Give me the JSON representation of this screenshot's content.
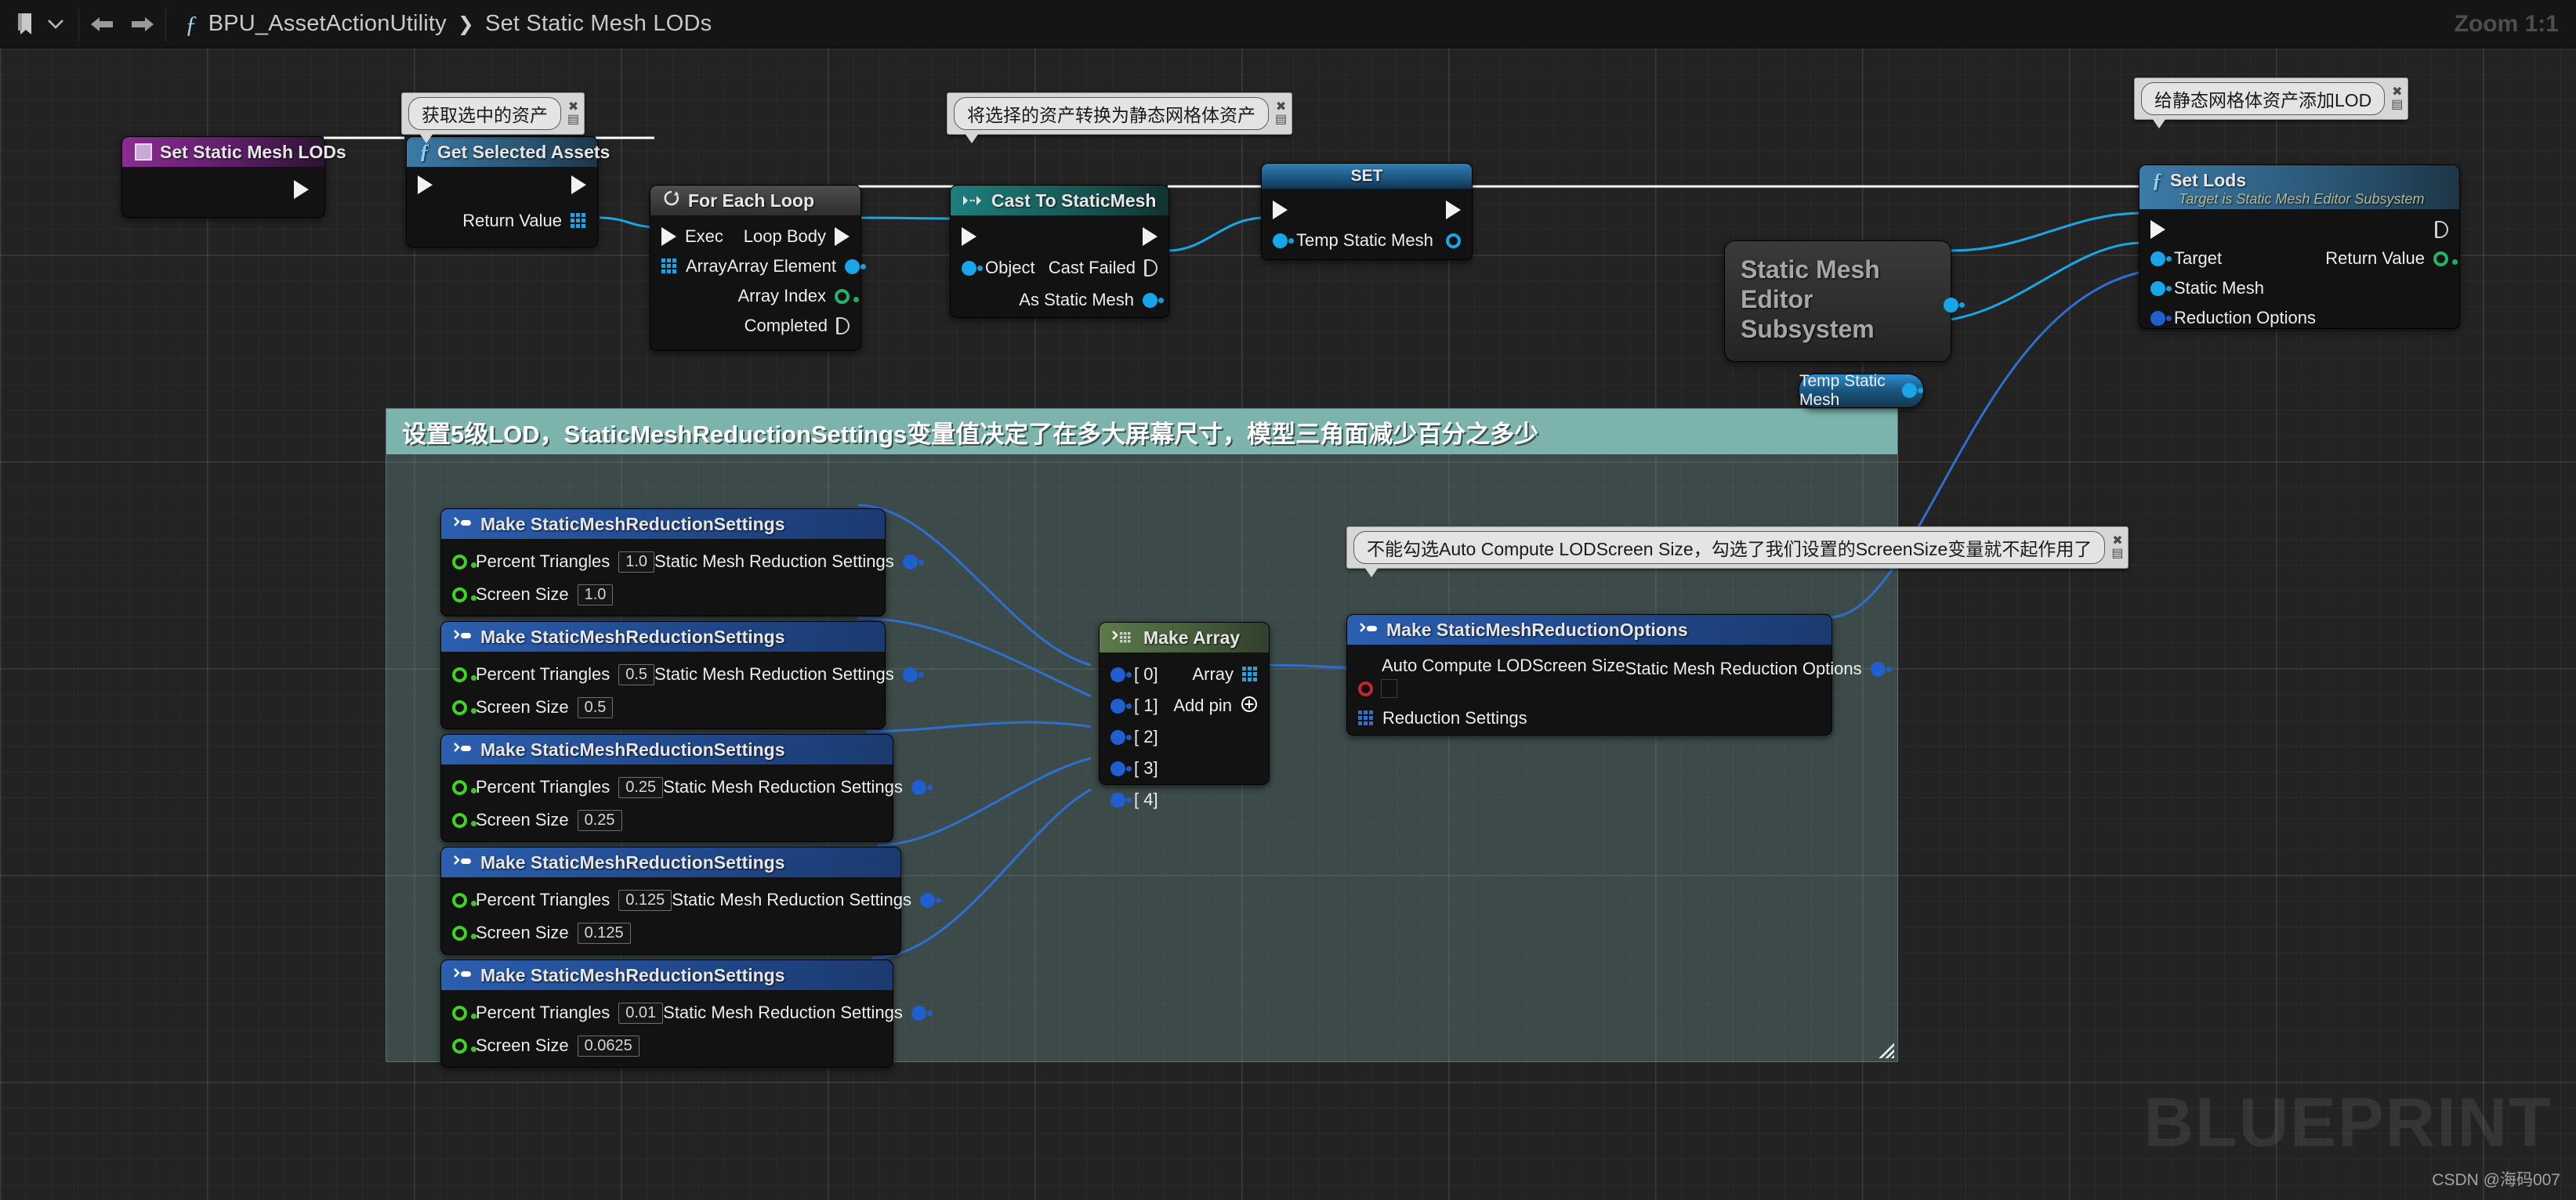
{
  "toolbar": {
    "bookmark_icon": "bookmark-icon",
    "dropdown_icon": "chevron-down-icon",
    "back_icon": "arrow-left-icon",
    "forward_icon": "arrow-right-icon",
    "function_icon": "function-fx-icon",
    "breadcrumb_root": "BPU_AssetActionUtility",
    "breadcrumb_sep": "❯",
    "breadcrumb_leaf": "Set Static Mesh LODs",
    "zoom_label": "Zoom 1:1"
  },
  "watermark": {
    "big": "BLUEPRINT",
    "credit": "CSDN @海码007"
  },
  "comment_box": {
    "title": "设置5级LOD，StaticMeshReductionSettings变量值决定了在多大屏幕尺寸，模型三角面减少百分之多少",
    "color": "#7cb4ad"
  },
  "bubbles": [
    {
      "id": "bubble-get-selected-assets",
      "text": "获取选中的资产"
    },
    {
      "id": "bubble-cast-to-staticmesh",
      "text": "将选择的资产转换为静态网格体资产"
    },
    {
      "id": "bubble-set-lods",
      "text": "给静态网格体资产添加LOD"
    },
    {
      "id": "bubble-auto-compute",
      "text": "不能勾选Auto Compute LODScreen Size，勾选了我们设置的ScreenSize变量就不起作用了"
    }
  ],
  "nodes": {
    "entry": {
      "title": "Set Static Mesh LODs"
    },
    "get_selected_assets": {
      "title": "Get Selected Assets",
      "icon": "function-fx-icon",
      "out_value": "Return Value"
    },
    "for_each_loop": {
      "title": "For Each Loop",
      "icon": "loop-icon",
      "in_exec": "Exec",
      "in_array": "Array",
      "out_loop_body": "Loop Body",
      "out_array_element": "Array Element",
      "out_array_index": "Array Index",
      "out_completed": "Completed"
    },
    "cast_to_staticmesh": {
      "title": "Cast To StaticMesh",
      "icon": "cast-icon",
      "in_object": "Object",
      "out_cast_failed": "Cast Failed",
      "out_as_static_mesh": "As Static Mesh"
    },
    "set_node": {
      "title": "SET",
      "in_temp_static_mesh": "Temp Static Mesh"
    },
    "subsystem": {
      "title": "Static Mesh Editor Subsystem"
    },
    "temp_static_mesh_get": {
      "title": "Temp Static Mesh"
    },
    "set_lods": {
      "title": "Set Lods",
      "subtitle": "Target is Static Mesh Editor Subsystem",
      "icon": "function-fx-icon",
      "in_target": "Target",
      "in_static_mesh": "Static Mesh",
      "in_reduction_options": "Reduction Options",
      "out_return_value": "Return Value"
    },
    "make_array": {
      "title": "Make Array",
      "icon": "make-array-icon",
      "pins": [
        "[ 0]",
        "[ 1]",
        "[ 2]",
        "[ 3]",
        "[ 4]"
      ],
      "out_array": "Array",
      "add_pin": "Add pin"
    },
    "make_reduction_options": {
      "title": "Make StaticMeshReductionOptions",
      "icon": "make-struct-icon",
      "in_auto_compute": "Auto Compute LODScreen Size",
      "auto_compute_checked": false,
      "in_reduction_settings": "Reduction Settings",
      "out_options": "Static Mesh Reduction Options"
    },
    "reduction_settings_common": {
      "title": "Make StaticMeshReductionSettings",
      "icon": "make-struct-icon",
      "in_percent_triangles": "Percent Triangles",
      "in_screen_size": "Screen Size",
      "out_settings": "Static Mesh Reduction Settings"
    },
    "reduction_settings_list": [
      {
        "percent_triangles": "1.0",
        "screen_size": "1.0"
      },
      {
        "percent_triangles": "0.5",
        "screen_size": "0.5"
      },
      {
        "percent_triangles": "0.25",
        "screen_size": "0.25"
      },
      {
        "percent_triangles": "0.125",
        "screen_size": "0.125"
      },
      {
        "percent_triangles": "0.01",
        "screen_size": "0.0625"
      }
    ]
  },
  "colors": {
    "exec_wire": "#ffffff",
    "object_wire": "#1b9fe0",
    "struct_wire": "#2f6fd0",
    "comment": "#7cb4ad",
    "canvas": "#232323"
  }
}
